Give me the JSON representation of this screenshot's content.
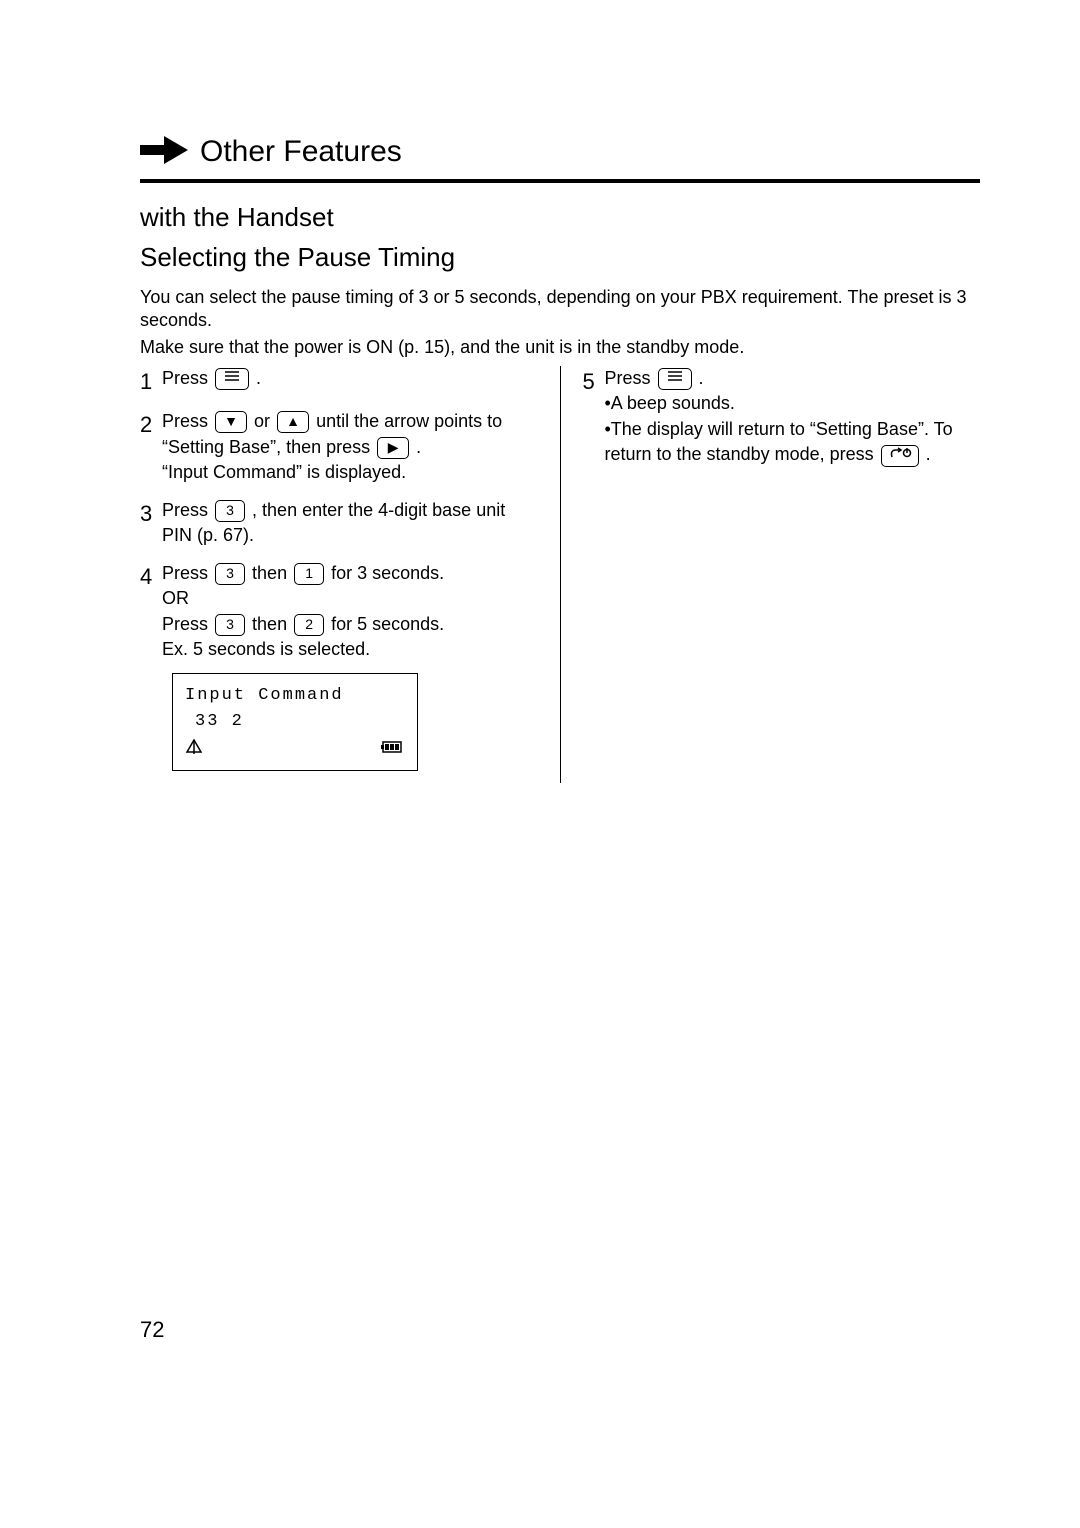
{
  "header": {
    "section_title": "Other Features"
  },
  "subtitle_line1": "with the Handset",
  "subtitle_line2": "Selecting the Pause Timing",
  "intro_p1": "You can select the pause timing of 3 or 5 seconds, depending on your PBX requirement. The preset is 3 seconds.",
  "intro_p2": "Make sure that the power is ON (p. 15), and the unit is in the standby mode.",
  "left": {
    "s1": {
      "num": "1",
      "a": "Press",
      "b": "."
    },
    "s2": {
      "num": "2",
      "a": "Press",
      "b": " or ",
      "c": " until the arrow points to “",
      "d": "Setting Base",
      "e": "”, then press ",
      "f": ".",
      "g": "“Input Command” is displayed."
    },
    "s3": {
      "num": "3",
      "a": "Press",
      "b": ", then enter the 4-digit base unit PIN (p. 67)."
    },
    "s4": {
      "num": "4",
      "a": "Press",
      "b": " then ",
      "c": " for 3 seconds.",
      "or": "OR",
      "d": "Press",
      "e": " then ",
      "f": " for 5 seconds.",
      "ex": "Ex. 5 seconds is selected."
    }
  },
  "lcd": {
    "l1": "Input Command",
    "l2": "33 2"
  },
  "right": {
    "s5": {
      "num": "5",
      "a": "Press",
      "b": ".",
      "line1": "•A beep sounds.",
      "line2a": "•The display will return to “",
      "line2b": "Setting Base",
      "line2c": "”. To return to the standby mode, press ",
      "line2d": "."
    }
  },
  "page_number": "72"
}
